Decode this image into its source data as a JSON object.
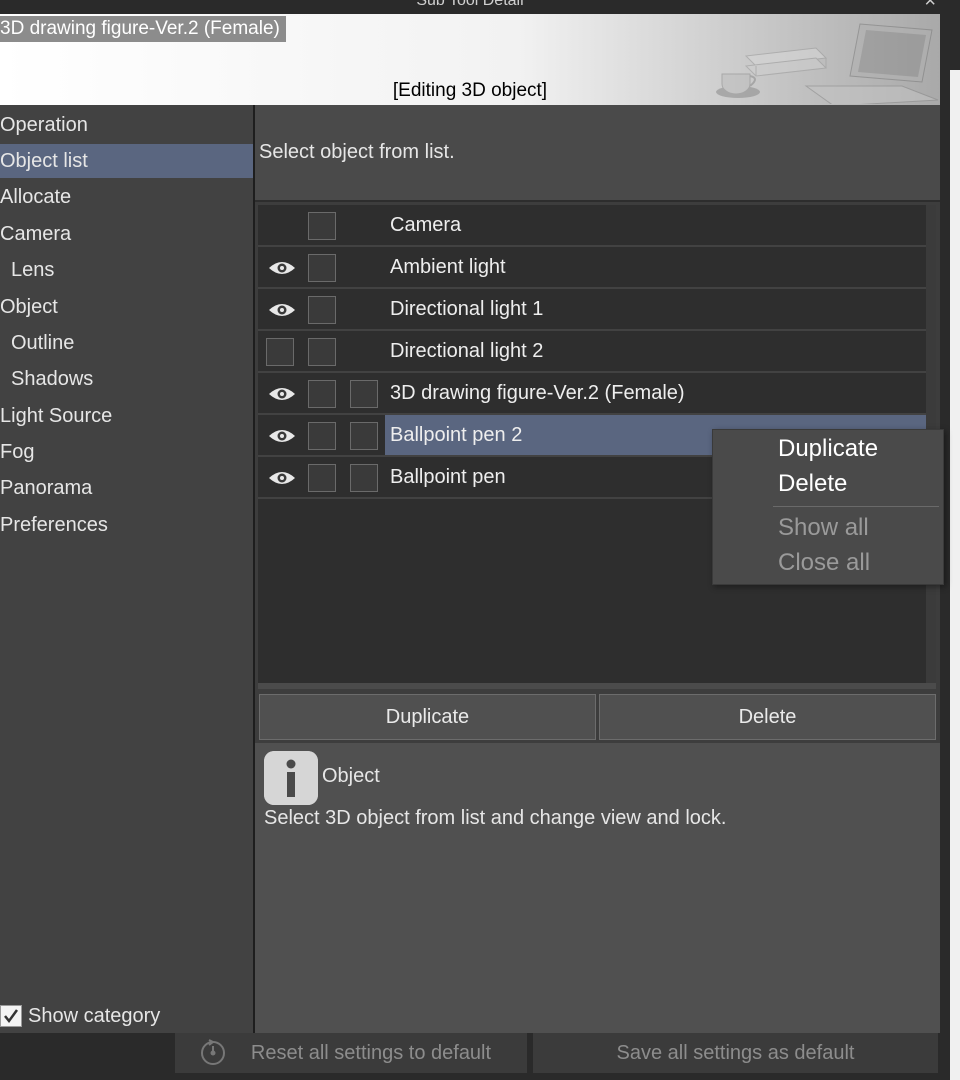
{
  "window": {
    "title": "Sub Tool Detail",
    "close_symbol": "×"
  },
  "header": {
    "figure_name": "3D drawing figure-Ver.2 (Female)",
    "status": "[Editing 3D object]"
  },
  "sidebar": {
    "items": [
      {
        "label": "Operation"
      },
      {
        "label": "Object list"
      },
      {
        "label": "Allocate"
      },
      {
        "label": "Camera"
      },
      {
        "label": "Lens"
      },
      {
        "label": "Object"
      },
      {
        "label": "Outline"
      },
      {
        "label": "Shadows"
      },
      {
        "label": "Light Source"
      },
      {
        "label": "Fog"
      },
      {
        "label": "Panorama"
      },
      {
        "label": "Preferences"
      }
    ],
    "selected_index": 1,
    "show_category": {
      "label": "Show category",
      "checked": true
    }
  },
  "main": {
    "instruction": "Select object from list.",
    "objects": [
      {
        "name": "Camera",
        "visible": false
      },
      {
        "name": "Ambient light",
        "visible": true
      },
      {
        "name": "Directional light 1",
        "visible": true
      },
      {
        "name": "Directional light 2",
        "visible": false
      },
      {
        "name": "3D drawing figure-Ver.2 (Female)",
        "visible": true
      },
      {
        "name": "Ballpoint pen 2",
        "visible": true,
        "selected": true
      },
      {
        "name": "Ballpoint pen",
        "visible": true
      }
    ],
    "duplicate_label": "Duplicate",
    "delete_label": "Delete",
    "info": {
      "icon": "info-icon",
      "title": "Object",
      "description": "Select 3D object from list and change view and lock."
    }
  },
  "context_menu": {
    "items": [
      {
        "label": "Duplicate",
        "enabled": true
      },
      {
        "label": "Delete",
        "enabled": true
      },
      {
        "label": "Show all",
        "enabled": false
      },
      {
        "label": "Close all",
        "enabled": false
      }
    ]
  },
  "footer": {
    "reset_label": "Reset all settings to default",
    "save_label": "Save all settings as default"
  },
  "colors": {
    "selection": "#5a6680",
    "panel": "#424242",
    "list_bg": "#2e2e2e"
  }
}
